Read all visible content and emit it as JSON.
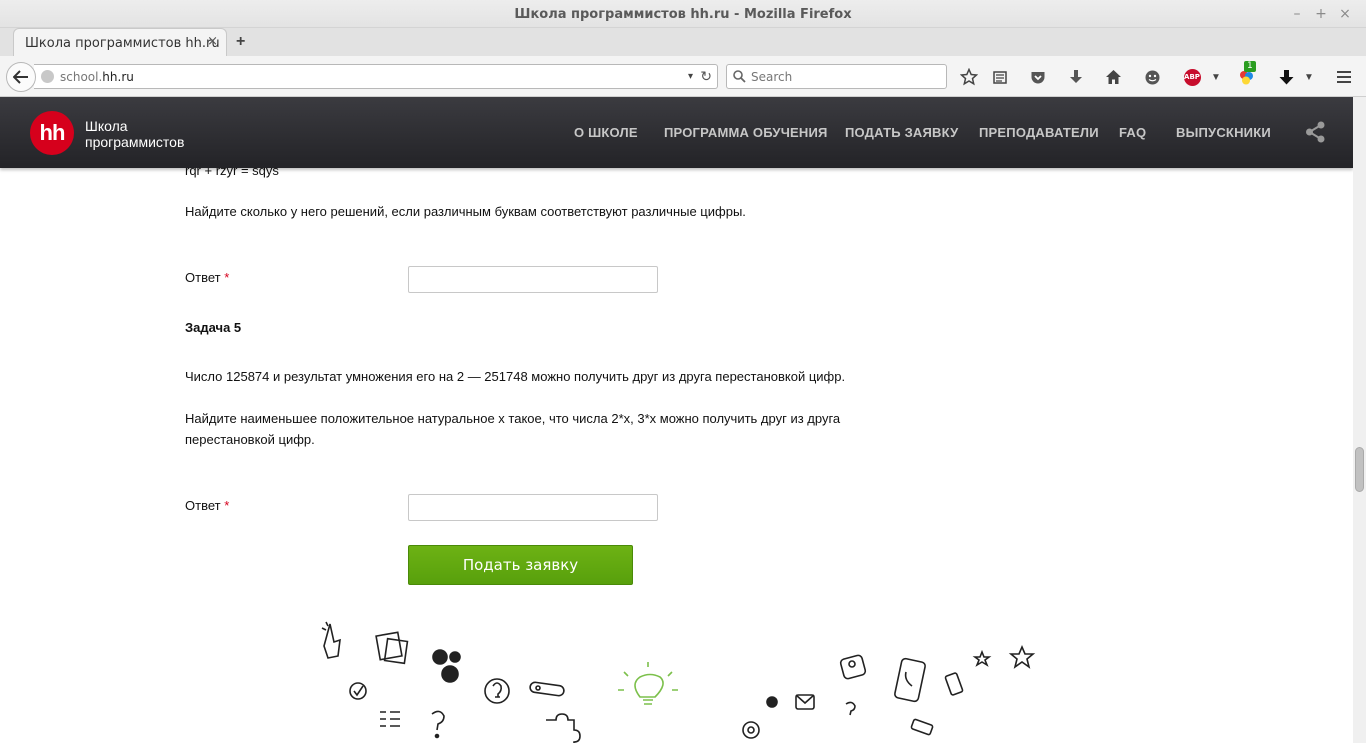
{
  "window": {
    "title": "Школа программистов hh.ru - Mozilla Firefox",
    "minimize": "–",
    "maximize": "+",
    "close": "×"
  },
  "tabs": [
    {
      "label": "Школа программистов hh.ru",
      "close": "×",
      "active": true
    }
  ],
  "newtab_label": "+",
  "urlbar": {
    "url_prefix": "school.",
    "url_domain": "hh.ru",
    "dropdown": "▾",
    "reload": "↻"
  },
  "searchbar": {
    "placeholder": "Search"
  },
  "toolbar": {
    "icons": [
      "bookmark-star-icon",
      "reading-list-icon",
      "pocket-icon",
      "download-icon",
      "home-icon",
      "emoji-icon",
      "adblock-icon",
      "extension-icon",
      "downloads-icon",
      "menu-icon"
    ],
    "abp_label": "ABP",
    "extension_badge": "1"
  },
  "site": {
    "logo_text": "hh",
    "name_line1": "Школа",
    "name_line2": "программистов",
    "nav": [
      "О ШКОЛЕ",
      "ПРОГРАММА ОБУЧЕНИЯ",
      "ПОДАТЬ ЗАЯВКУ",
      "ПРЕПОДАВАТЕЛИ",
      "FAQ",
      "ВЫПУСКНИКИ"
    ]
  },
  "form": {
    "prev_equation": "rqr + rzyr = sqys",
    "prev_question": "Найдите сколько у него решений, если различным буквам соответствуют различные цифры.",
    "answer_label": "Ответ",
    "required_mark": "*",
    "task5_title": "Задача 5",
    "task5_p1": "Число 125874 и результат умножения его на 2 — 251748 можно получить друг из друга перестановкой цифр.",
    "task5_p2_line1": "Найдите наименьшее положительное натуральное x такое, что числа 2*x, 3*x можно получить друг из друга",
    "task5_p2_line2": "перестановкой цифр.",
    "answer1_value": "",
    "answer2_value": "",
    "submit_label": "Подать заявку"
  },
  "colors": {
    "brand_red": "#d6001c",
    "header_dark": "#2b2b30",
    "submit_green": "#62a80f"
  }
}
